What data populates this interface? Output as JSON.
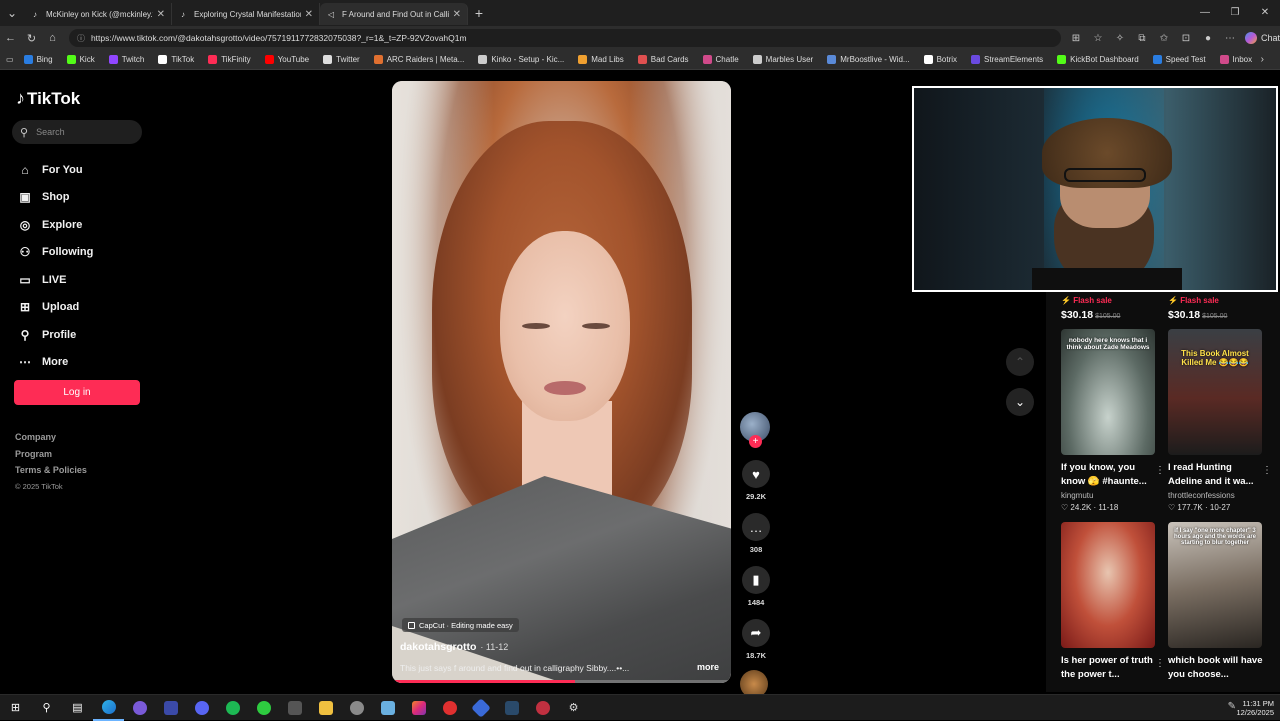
{
  "browser": {
    "tabs": [
      {
        "title": "McKinley on Kick (@mckinley.tv) |",
        "icon": "tiktok-icon",
        "active": false
      },
      {
        "title": "Exploring Crystal Manifestation an",
        "icon": "tiktok-icon",
        "active": false
      },
      {
        "title": "F Around and Find Out in Calli",
        "icon": "speaker-icon",
        "active": true
      }
    ],
    "url": "https://www.tiktok.com/@dakotahsgrotto/video/7571911772832075038?_r=1&_t=ZP-92V2ovahQ1m",
    "chat_label": "Chat",
    "bookmarks": [
      {
        "label": "Bing",
        "color": "#2a7de1"
      },
      {
        "label": "Kick",
        "color": "#53fc18"
      },
      {
        "label": "Twitch",
        "color": "#9146ff"
      },
      {
        "label": "TikTok",
        "color": "#ffffff"
      },
      {
        "label": "TikFinity",
        "color": "#fe2c55"
      },
      {
        "label": "YouTube",
        "color": "#ff0000"
      },
      {
        "label": "Twitter",
        "color": "#dddddd"
      },
      {
        "label": "ARC Raiders | Meta...",
        "color": "#e07030"
      },
      {
        "label": "Kinko - Setup - Kic...",
        "color": "#cccccc"
      },
      {
        "label": "Mad Libs",
        "color": "#f0a030"
      },
      {
        "label": "Bad Cards",
        "color": "#e05050"
      },
      {
        "label": "Chatle",
        "color": "#d04a8a"
      },
      {
        "label": "Marbles User",
        "color": "#cccccc"
      },
      {
        "label": "MrBoostlive - Wid...",
        "color": "#5a8ad8"
      },
      {
        "label": "Botrix",
        "color": "#ffffff"
      },
      {
        "label": "StreamElements",
        "color": "#6a4ae0"
      },
      {
        "label": "KickBot Dashboard",
        "color": "#53fc18"
      },
      {
        "label": "Speed Test",
        "color": "#2a7de1"
      },
      {
        "label": "Inbox",
        "color": "#d04a8a"
      }
    ]
  },
  "sidebar": {
    "logo": "TikTok",
    "search_placeholder": "Search",
    "nav": [
      {
        "label": "For You",
        "icon": "home-icon",
        "glyph": "⌂"
      },
      {
        "label": "Shop",
        "icon": "shop-bag-icon",
        "glyph": "▣"
      },
      {
        "label": "Explore",
        "icon": "compass-icon",
        "glyph": "◎"
      },
      {
        "label": "Following",
        "icon": "person-icon",
        "glyph": "⚇"
      },
      {
        "label": "LIVE",
        "icon": "live-icon",
        "glyph": "▭"
      },
      {
        "label": "Upload",
        "icon": "upload-icon",
        "glyph": "⊞"
      },
      {
        "label": "Profile",
        "icon": "profile-icon",
        "glyph": "⚲"
      },
      {
        "label": "More",
        "icon": "more-icon",
        "glyph": "⋯"
      }
    ],
    "login_label": "Log in",
    "footer": [
      "Company",
      "Program",
      "Terms & Policies"
    ],
    "copyright": "© 2025 TikTok"
  },
  "video": {
    "capcut_label": "CapCut · Editing made easy",
    "author": "dakotahsgrotto",
    "date": "· 11-12",
    "description": "This just says f around and find out in calligraphy Sibby....••...",
    "more_label": "more",
    "progress": 0.54,
    "likes": "29.2K",
    "comments": "308",
    "saves": "1484",
    "shares": "18.7K"
  },
  "recommendations": {
    "left": {
      "flash": "Flash sale",
      "price": "$30.18",
      "old_price": "$105.00",
      "items": [
        {
          "overlay": "nobody here knows that i think about Zade Meadows",
          "title": "If you know, you know 🫣 #haunte...",
          "author": "kingmutu",
          "count": "24.2K · 11-18"
        },
        {
          "overlay": "",
          "title": "Is her power of truth the power t...",
          "author": "",
          "count": ""
        }
      ]
    },
    "right": {
      "flash": "Flash sale",
      "price": "$30.18",
      "old_price": "$105.00",
      "items": [
        {
          "overlay": "This Book Almost Killed Me 😂😂😂",
          "title": "I read Hunting Adeline and it wa...",
          "author": "throttleconfessions",
          "count": "177.7K · 10-27"
        },
        {
          "overlay": "if I say \"one more chapter\" 3 hours ago and the words are starting to blur together",
          "title": "which book will have you choose...",
          "author": "",
          "count": ""
        }
      ]
    }
  },
  "taskbar": {
    "time": "11:31 PM",
    "date": "12/26/2025"
  }
}
